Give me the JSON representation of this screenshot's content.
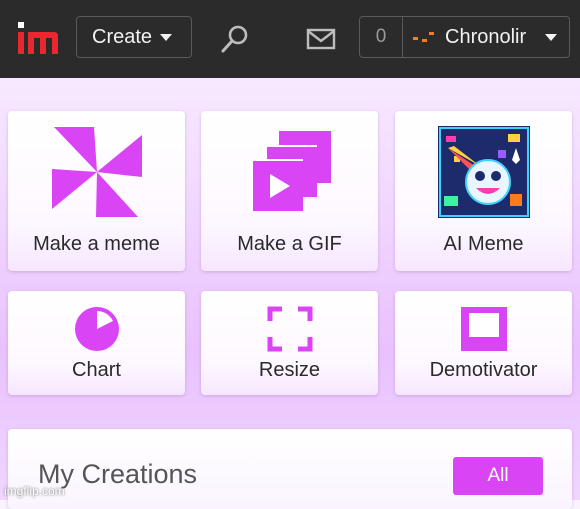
{
  "header": {
    "create_label": "Create",
    "notification_count": "0",
    "username": "Chronolir"
  },
  "tiles": [
    {
      "label": "Make a meme",
      "icon": "pinwheel-icon"
    },
    {
      "label": "Make a GIF",
      "icon": "stacked-frames-play-icon"
    },
    {
      "label": "AI Meme",
      "icon": "ai-robot-face-icon"
    },
    {
      "label": "Chart",
      "icon": "pie-chart-icon"
    },
    {
      "label": "Resize",
      "icon": "resize-corners-icon"
    },
    {
      "label": "Demotivator",
      "icon": "framed-picture-icon"
    }
  ],
  "creations": {
    "title": "My Creations",
    "all_label": "All"
  },
  "watermark": "imgflip.com",
  "colors": {
    "accent": "#d944f5",
    "topbar": "#2b2b2b",
    "logo_red": "#e8272f"
  }
}
